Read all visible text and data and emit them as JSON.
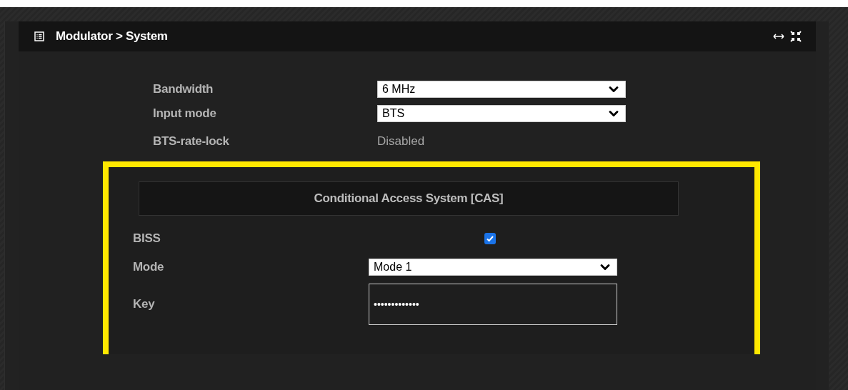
{
  "panel": {
    "title": "Modulator > System"
  },
  "fields": [
    {
      "kind": "select",
      "label": "Bandwidth",
      "value": "6 MHz"
    },
    {
      "kind": "select",
      "label": "Input mode",
      "value": "BTS"
    },
    {
      "kind": "text",
      "label": "BTS-rate-lock",
      "value": "Disabled"
    }
  ],
  "cas": {
    "title": "Conditional Access System [CAS]",
    "fields": [
      {
        "kind": "checkbox",
        "label": "BISS",
        "checked": true
      },
      {
        "kind": "select",
        "label": "Mode",
        "value": "Mode 1"
      },
      {
        "kind": "password",
        "label": "Key",
        "value": "•••••••••••••"
      }
    ]
  }
}
